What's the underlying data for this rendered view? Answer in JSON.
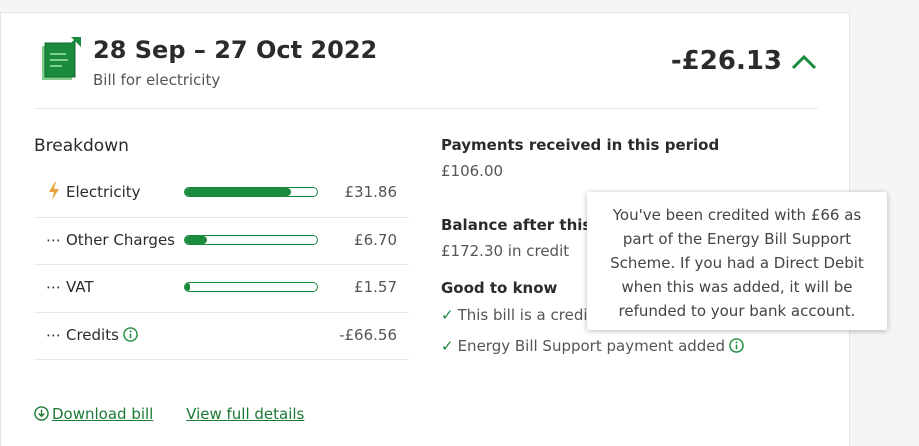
{
  "bill": {
    "period": "28 Sep – 27 Oct 2022",
    "description": "Bill for electricity",
    "amount": "-£26.13",
    "icon": "bill-document-icon",
    "toggle_icon": "chevron-up-icon"
  },
  "breakdown": {
    "title": "Breakdown",
    "rows": [
      {
        "icon": "lightning-icon",
        "glyph": "⚡",
        "label": "Electricity",
        "bar_fraction": 0.8,
        "value": "£31.86"
      },
      {
        "icon": "ellipsis-icon",
        "glyph": "⋯",
        "label": "Other Charges",
        "bar_fraction": 0.17,
        "value": "£6.70"
      },
      {
        "icon": "ellipsis-icon",
        "glyph": "⋯",
        "label": "VAT",
        "bar_fraction": 0.04,
        "value": "£1.57"
      },
      {
        "icon": "ellipsis-icon",
        "glyph": "⋯",
        "label": "Credits",
        "info_icon": "info-icon",
        "value": "-£66.56"
      }
    ]
  },
  "payments": {
    "heading": "Payments received in this period",
    "value": "£106.00"
  },
  "balance": {
    "heading": "Balance after this b",
    "value": "£172.30 in credit"
  },
  "good_to_know": {
    "heading": "Good to know",
    "items": [
      "This bill is a credi",
      "Energy Bill Support payment added"
    ]
  },
  "tooltip": {
    "text": "You've been credited with £66 as part of the Energy Bill Support Scheme. If you had a Direct Debit when this was added, it will be refunded to your bank account."
  },
  "links": {
    "download": "Download bill",
    "view_details": "View full details"
  },
  "colors": {
    "accent": "#1a8a3c",
    "link": "#1a7a34"
  }
}
